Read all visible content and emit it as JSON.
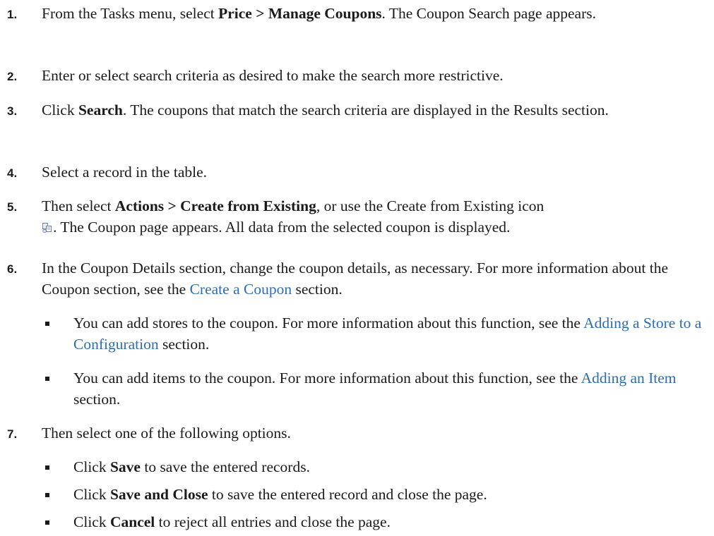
{
  "steps": [
    {
      "number": "1.",
      "parts": {
        "a": "From the Tasks menu, select ",
        "b": "Price > Manage Coupons",
        "c": ". The Coupon Search page appears."
      }
    },
    {
      "number": "2.",
      "parts": {
        "a": "Enter or select search criteria as desired to make the search more restrictive."
      }
    },
    {
      "number": "3.",
      "parts": {
        "a": "Click ",
        "b": "Search",
        "c": ". The coupons that match the search criteria are displayed in the Results section."
      }
    },
    {
      "number": "4.",
      "parts": {
        "a": "Select a record in the table."
      }
    },
    {
      "number": "5.",
      "parts": {
        "a": "Then select ",
        "b": "Actions > Create from Existing",
        "c": ", or use the Create from Existing icon",
        "d": ". The Coupon page appears. All data from the selected coupon is displayed."
      },
      "icon": "create-from-existing-icon"
    },
    {
      "number": "6.",
      "parts": {
        "a": "In the Coupon Details section, change the coupon details, as necessary. For more information about the Coupon section, see the ",
        "link": "Create a Coupon",
        "c": " section."
      },
      "bullets": [
        {
          "a": "You can add stores to the coupon. For more information about this function, see the ",
          "link": "Adding a Store to a Configuration",
          "c": " section."
        },
        {
          "a": "You can add items to the coupon. For more information about this function, see the ",
          "link": "Adding an Item",
          "c": " section."
        }
      ]
    },
    {
      "number": "7.",
      "parts": {
        "a": "Then select one of the following options."
      },
      "bullets": [
        {
          "a": "Click ",
          "b": "Save",
          "c": " to save the entered records."
        },
        {
          "a": "Click ",
          "b": "Save and Close",
          "c": " to save the entered record and close the page."
        },
        {
          "a": "Click ",
          "b": "Cancel",
          "c": " to reject all entries and close the page."
        }
      ]
    }
  ],
  "colors": {
    "text": "#1a1a1a",
    "link": "#2d6db3"
  }
}
